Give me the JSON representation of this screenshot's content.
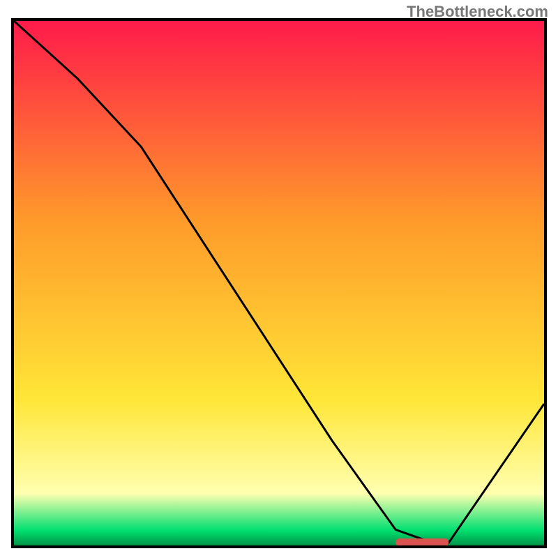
{
  "watermark": "TheBottleneck.com",
  "chart_data": {
    "type": "line",
    "title": "",
    "xlabel": "",
    "ylabel": "",
    "xlim": [
      0,
      100
    ],
    "ylim": [
      0,
      100
    ],
    "grid": false,
    "legend": false,
    "gradient": {
      "top": "#ff1a4a",
      "mid1": "#ff9a2a",
      "mid2": "#ffe637",
      "low": "#ffffb0",
      "bottom_band": "#00e070",
      "very_bottom": "#009045"
    },
    "series": [
      {
        "name": "bottleneck-curve",
        "x": [
          0,
          12,
          24,
          60,
          72,
          79,
          82,
          100
        ],
        "values": [
          100,
          89,
          76,
          20,
          3,
          0.5,
          0.5,
          27
        ]
      }
    ],
    "marker": {
      "name": "optimal-range",
      "x_start": 72,
      "x_end": 82,
      "y": 0.6,
      "color": "#d9534f"
    },
    "frame_color": "#000000",
    "frame_width": 4
  }
}
